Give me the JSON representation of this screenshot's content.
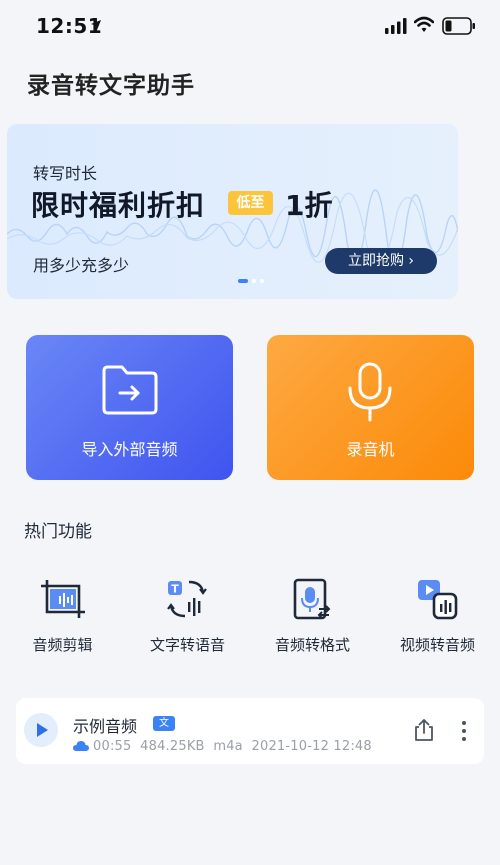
{
  "status_bar": {
    "time": "12:51"
  },
  "app": {
    "title": "录音转文字助手"
  },
  "banner": {
    "subtitle": "转写时长",
    "headline": "限时福利折扣",
    "badge": "低至",
    "discount": "1折",
    "tagline": "用多少充多少",
    "button": "立即抢购 ›",
    "active_slide": 1,
    "slide_count": 3
  },
  "actions": {
    "import_label": "导入外部音频",
    "record_label": "录音机"
  },
  "hot": {
    "title": "热门功能",
    "items": [
      {
        "label": "音频剪辑",
        "icon": "audio-crop-icon"
      },
      {
        "label": "文字转语音",
        "icon": "text-to-speech-icon"
      },
      {
        "label": "音频转格式",
        "icon": "audio-convert-icon"
      },
      {
        "label": "视频转音频",
        "icon": "video-to-audio-icon"
      }
    ]
  },
  "audio": {
    "title": "示例音频",
    "badge": "文",
    "duration": "00:55",
    "size": "484.25KB",
    "format": "m4a",
    "date": "2021-10-12 12:48"
  },
  "colors": {
    "accent": "#3b82f6",
    "import_card": "#4a62f2",
    "record_card": "#fc9420",
    "banner_button": "#1e3a6b",
    "badge": "#fbc43a"
  }
}
